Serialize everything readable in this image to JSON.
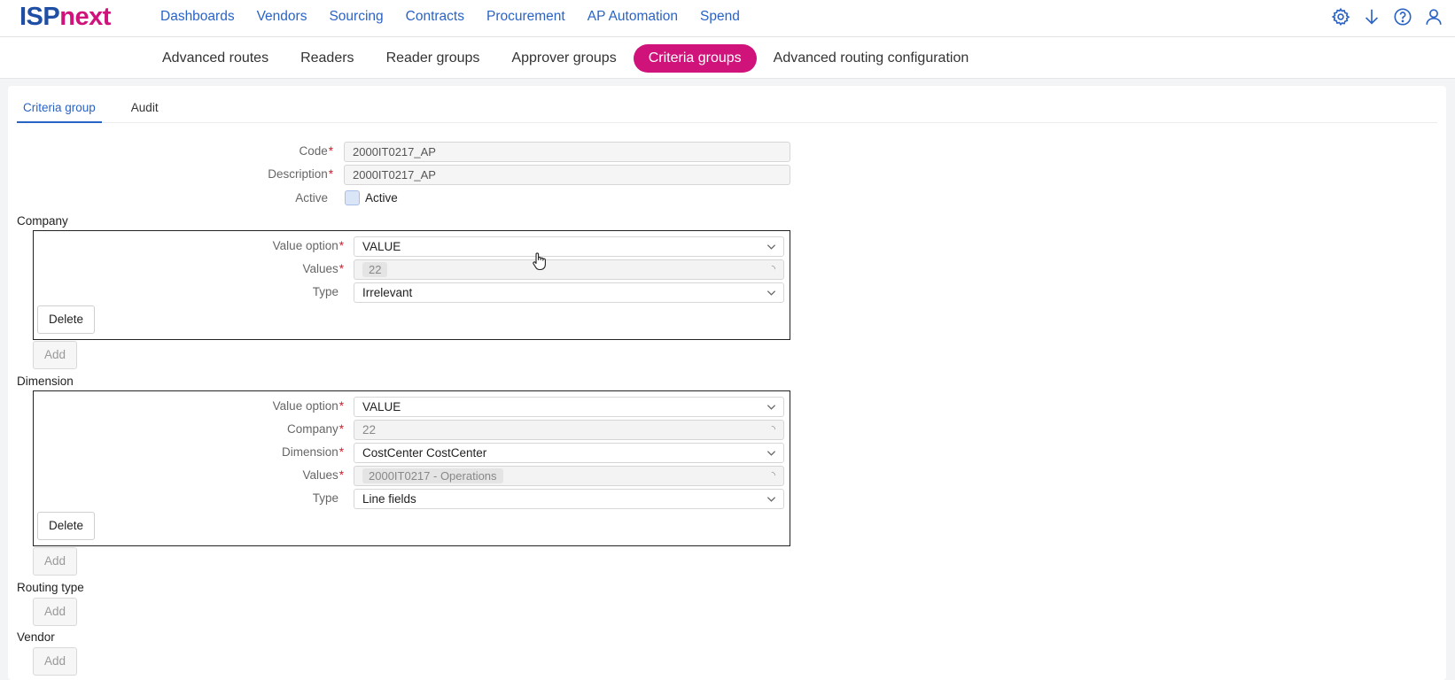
{
  "brand": {
    "isp": "ISP",
    "next": "next"
  },
  "main_nav": [
    "Dashboards",
    "Vendors",
    "Sourcing",
    "Contracts",
    "Procurement",
    "AP Automation",
    "Spend"
  ],
  "top_icons": [
    "settings-icon",
    "download-icon",
    "help-icon",
    "user-icon"
  ],
  "sub_nav": {
    "items": [
      "Advanced routes",
      "Readers",
      "Reader groups",
      "Approver groups",
      "Criteria groups",
      "Advanced routing configuration"
    ],
    "active": "Criteria groups"
  },
  "tabs": {
    "items": [
      "Criteria group",
      "Audit"
    ],
    "active": "Criteria group"
  },
  "header_form": {
    "code_label": "Code",
    "code_value": "2000IT0217_AP",
    "description_label": "Description",
    "description_value": "2000IT0217_AP",
    "active_label": "Active",
    "active_checkbox_label": "Active"
  },
  "company": {
    "title": "Company",
    "value_option_label": "Value option",
    "value_option": "VALUE",
    "values_label": "Values",
    "values": [
      "22"
    ],
    "type_label": "Type",
    "type": "Irrelevant",
    "delete_label": "Delete",
    "add_label": "Add"
  },
  "dimension": {
    "title": "Dimension",
    "value_option_label": "Value option",
    "value_option": "VALUE",
    "company_label": "Company",
    "company": "22",
    "dimension_label": "Dimension",
    "dimension": "CostCenter CostCenter",
    "values_label": "Values",
    "values": [
      "2000IT0217 - Operations"
    ],
    "type_label": "Type",
    "type": "Line fields",
    "delete_label": "Delete",
    "add_label": "Add"
  },
  "routing_type": {
    "title": "Routing type",
    "add_label": "Add"
  },
  "vendor": {
    "title": "Vendor",
    "add_label": "Add"
  },
  "colors": {
    "brand_blue": "#1f4ea5",
    "brand_magenta": "#d0127b",
    "link_blue": "#2a63c6",
    "required_red": "#d21a2a"
  }
}
